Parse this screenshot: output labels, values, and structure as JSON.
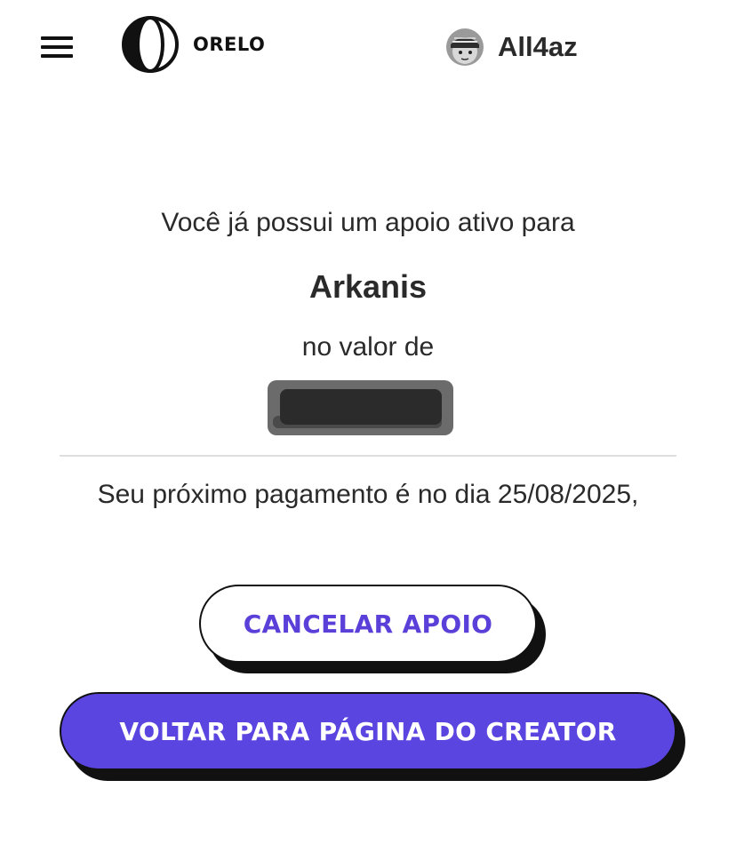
{
  "header": {
    "logo_text": "ORELO",
    "username": "All4az"
  },
  "support": {
    "intro": "Você já possui um apoio ativo para",
    "creator_name": "Arkanis",
    "value_label": "no valor de",
    "next_payment": "Seu próximo pagamento é no dia 25/08/2025,"
  },
  "buttons": {
    "cancel_label": "CANCELAR APOIO",
    "back_label": "VOLTAR PARA PÁGINA DO CREATOR"
  },
  "icons": {
    "menu": "hamburger-menu-icon",
    "logo": "orelo-logo-icon",
    "avatar": "user-avatar"
  },
  "colors": {
    "accent": "#5b45e0",
    "accent_text": "#5b3fd9",
    "text": "#2a2a2a",
    "shadow": "#111111"
  }
}
